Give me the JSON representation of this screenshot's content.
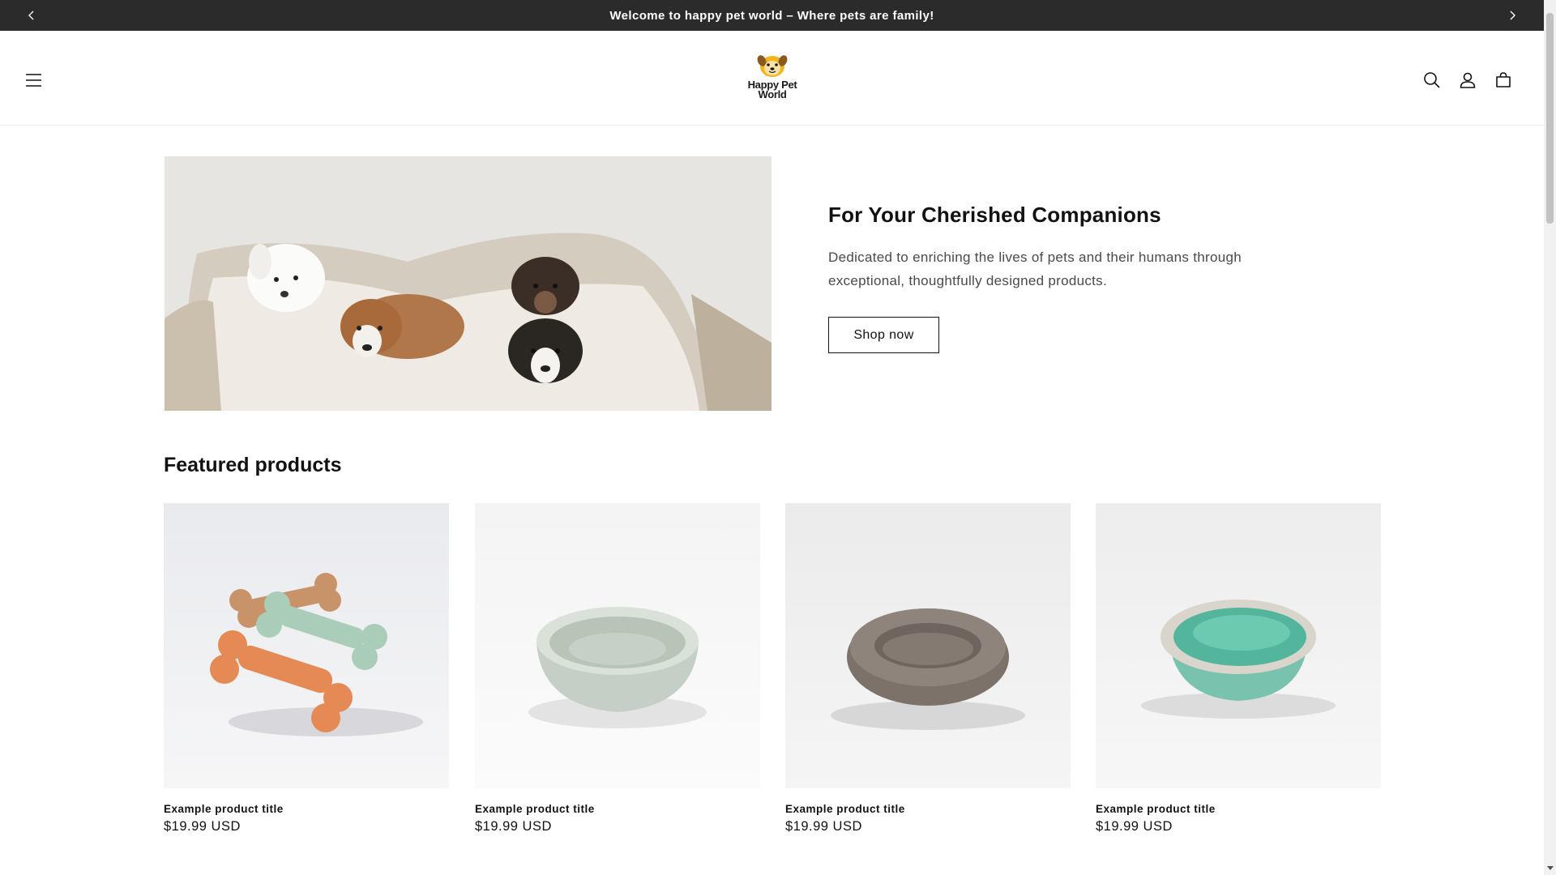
{
  "announcement": {
    "text": "Welcome to happy pet world – Where pets are family!",
    "prev_icon": "chevron-left-icon",
    "next_icon": "chevron-right-icon"
  },
  "header": {
    "logo_line1": "Happy Pet",
    "logo_line2": "World",
    "menu_icon": "hamburger-menu-icon",
    "search_icon": "search-icon",
    "account_icon": "account-icon",
    "cart_icon": "cart-icon"
  },
  "hero": {
    "image": "puppies-in-pet-bed",
    "title": "For Your Cherished Companions",
    "description": "Dedicated to enriching the lives of pets and their humans through exceptional, thoughtfully designed products.",
    "button_label": "Shop now"
  },
  "featured": {
    "heading": "Featured products",
    "products": [
      {
        "image": "dog-bone-toys",
        "title": "Example product title",
        "price": "$19.99 USD"
      },
      {
        "image": "ceramic-pet-bowl",
        "title": "Example product title",
        "price": "$19.99 USD"
      },
      {
        "image": "round-pet-bed",
        "title": "Example product title",
        "price": "$19.99 USD"
      },
      {
        "image": "litter-box",
        "title": "Example product title",
        "price": "$19.99 USD"
      }
    ]
  },
  "colors": {
    "announcement_bg": "#2b2b2b",
    "text": "#121212",
    "muted_text": "#4a4a4a"
  }
}
